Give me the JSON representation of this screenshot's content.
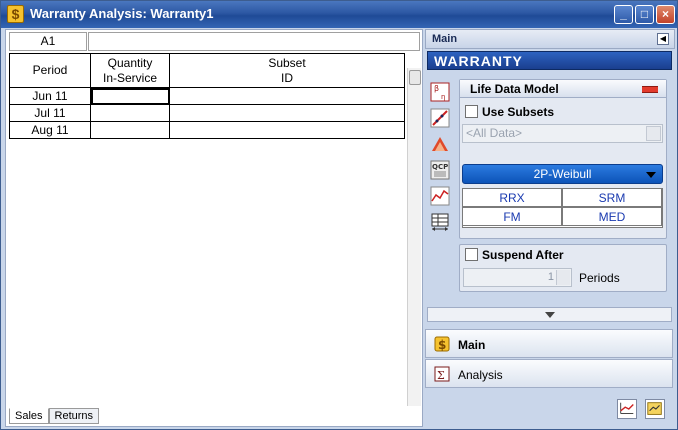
{
  "window": {
    "title": "Warranty Analysis: Warranty1"
  },
  "formula_bar": {
    "cell_ref": "A1",
    "value": ""
  },
  "sheet": {
    "headers": [
      "Period",
      "Quantity\nIn-Service",
      "Subset\nID"
    ],
    "header_lines": [
      [
        "Period"
      ],
      [
        "Quantity",
        "In-Service"
      ],
      [
        "Subset",
        "ID"
      ]
    ],
    "rows": [
      {
        "period": "Jun 11",
        "quantity": "",
        "subset": ""
      },
      {
        "period": "Jul 11",
        "quantity": "",
        "subset": ""
      },
      {
        "period": "Aug 11",
        "quantity": "",
        "subset": ""
      }
    ],
    "tabs": [
      "Sales",
      "Returns"
    ],
    "active_tab": "Sales"
  },
  "panel": {
    "header": "Main",
    "banner": "WARRANTY",
    "life_data_model": {
      "title": "Life Data Model",
      "use_subsets_label": "Use Subsets",
      "use_subsets_checked": false,
      "subset_combo": "<All Data>",
      "distribution": "2P-Weibull",
      "options": [
        "RRX",
        "SRM",
        "FM",
        "MED"
      ]
    },
    "suspend_after": {
      "label": "Suspend After",
      "checked": false,
      "value": "1",
      "unit": "Periods"
    },
    "nav": [
      {
        "label": "Main",
        "icon": "dollar-icon",
        "bold": true
      },
      {
        "label": "Analysis",
        "icon": "analysis-icon",
        "bold": false
      }
    ],
    "toolbar_icons": [
      "beta-icon",
      "plot-line-icon",
      "triangle-icon",
      "qcp-icon",
      "chart-icon",
      "table-arrows-icon"
    ],
    "bottom_icons": [
      "plot-icon",
      "report-icon"
    ]
  }
}
